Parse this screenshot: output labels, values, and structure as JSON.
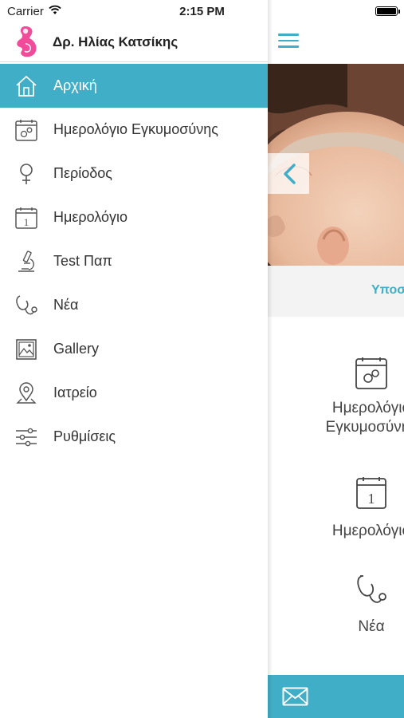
{
  "status_bar": {
    "carrier": "Carrier",
    "time": "2:15 PM",
    "wifi_icon": "wifi-icon",
    "battery_icon": "battery-icon"
  },
  "drawer": {
    "logo_icon": "pregnancy-logo-icon",
    "doctor_name": "Δρ. Ηλίας Κατσίκης",
    "items": [
      {
        "label": "Αρχική",
        "icon": "home-icon",
        "active": true
      },
      {
        "label": "Ημερολόγιο Εγκυμοσύνης",
        "icon": "pregnancy-calendar-icon",
        "active": false
      },
      {
        "label": "Περίοδος",
        "icon": "female-symbol-icon",
        "active": false
      },
      {
        "label": "Ημερολόγιο",
        "icon": "calendar-icon",
        "active": false
      },
      {
        "label": "Test Παπ",
        "icon": "microscope-icon",
        "active": false
      },
      {
        "label": "Νέα",
        "icon": "stethoscope-icon",
        "active": false
      },
      {
        "label": "Gallery",
        "icon": "gallery-icon",
        "active": false
      },
      {
        "label": "Ιατρείο",
        "icon": "location-pin-icon",
        "active": false
      },
      {
        "label": "Ρυθμίσεις",
        "icon": "sliders-icon",
        "active": false
      }
    ]
  },
  "main": {
    "menu_icon": "hamburger-icon",
    "slider_prev_icon": "chevron-left-icon",
    "hero_caption": "Υποσ",
    "tiles": [
      {
        "label_line1": "Ημερολόγιο",
        "label_line2": "Εγκυμοσύνης",
        "icon": "pregnancy-calendar-icon"
      },
      {
        "label_line1": "Ημερολόγιο",
        "icon": "calendar-icon"
      },
      {
        "label_line1": "Νέα",
        "icon": "stethoscope-icon"
      }
    ],
    "bottom_bar_icon": "mail-icon"
  },
  "colors": {
    "accent": "#41aec8",
    "text": "#333333"
  }
}
